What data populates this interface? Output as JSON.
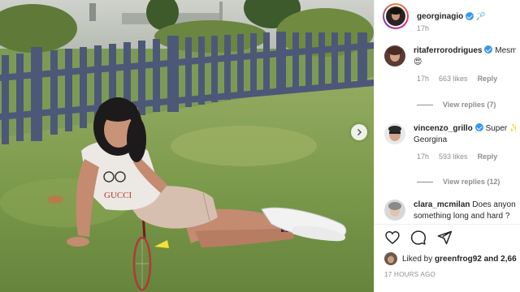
{
  "post": {
    "username": "georginagio",
    "header_emoji": "🏸",
    "time": "17h",
    "liked_by_prefix": "Liked by",
    "liked_by_user": "greenfrog92",
    "liked_by_suffix": "and 2,66",
    "posted_time": "17 HOURS AGO"
  },
  "comments": [
    {
      "username": "ritaferrorodrigues",
      "text_line1": "Mesm",
      "text_line2": "😍",
      "time": "17h",
      "likes": "663 likes",
      "reply_label": "Reply",
      "view_replies": "View replies (7)"
    },
    {
      "username": "vincenzo_grillo",
      "text_line1": "Super ✨",
      "text_line2": "Georgina",
      "time": "17h",
      "likes": "593 likes",
      "reply_label": "Reply",
      "view_replies": "View replies (12)"
    },
    {
      "username": "clara_mcmilan",
      "text_line1": "Does anyon",
      "text_line2": "something long and hard ?"
    }
  ],
  "icons": {
    "like": "heart-icon",
    "comment": "comment-icon",
    "share": "paper-plane-icon",
    "next": "chevron-right-icon"
  },
  "colors": {
    "verified": "#3897f0",
    "meta_grey": "#8e8e8e",
    "text": "#262626"
  }
}
